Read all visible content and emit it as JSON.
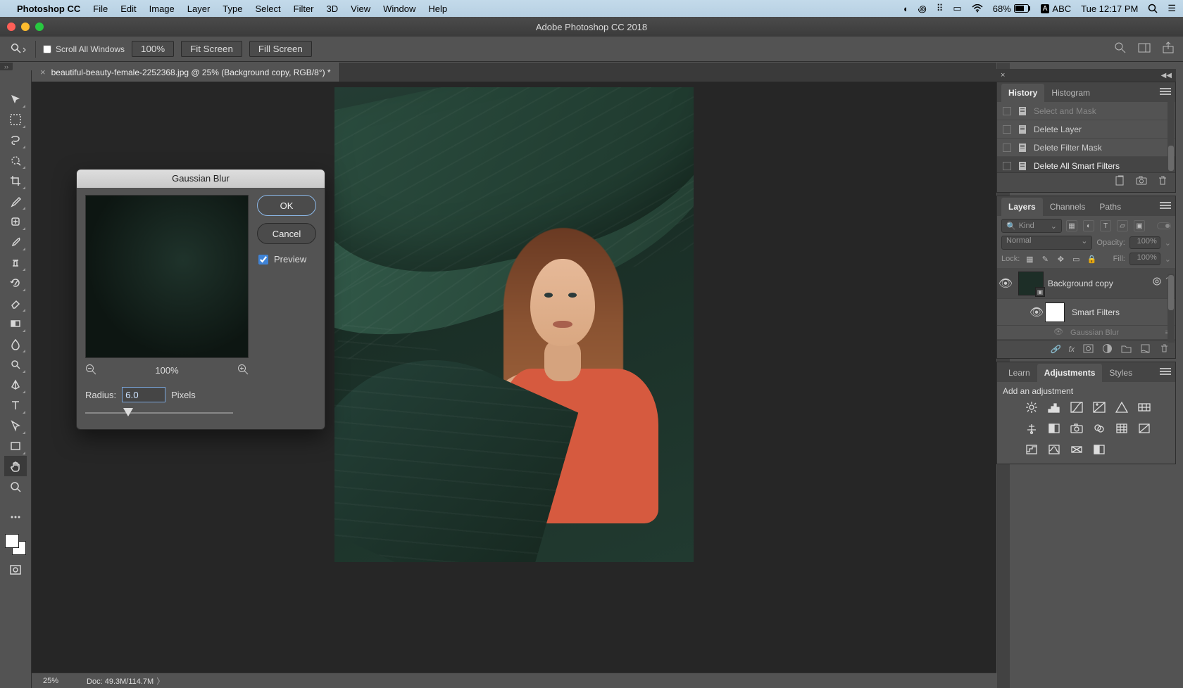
{
  "menubar": {
    "app": "Photoshop CC",
    "items": [
      "File",
      "Edit",
      "Image",
      "Layer",
      "Type",
      "Select",
      "Filter",
      "3D",
      "View",
      "Window",
      "Help"
    ],
    "battery": "68%",
    "input_badge": "A",
    "input_lang": "ABC",
    "clock": "Tue 12:17 PM"
  },
  "window": {
    "title": "Adobe Photoshop CC 2018"
  },
  "options_bar": {
    "scroll_all": "Scroll All Windows",
    "zoom": "100%",
    "fit": "Fit Screen",
    "fill": "Fill Screen"
  },
  "document_tab": {
    "close": "×",
    "label": "beautiful-beauty-female-2252368.jpg @ 25% (Background copy, RGB/8°) *"
  },
  "tools": [
    {
      "n": "move-tool"
    },
    {
      "n": "marquee-tool"
    },
    {
      "n": "lasso-tool"
    },
    {
      "n": "quick-select-tool"
    },
    {
      "n": "crop-tool"
    },
    {
      "n": "eyedropper-tool"
    },
    {
      "n": "healing-brush-tool"
    },
    {
      "n": "brush-tool"
    },
    {
      "n": "clone-stamp-tool"
    },
    {
      "n": "history-brush-tool"
    },
    {
      "n": "eraser-tool"
    },
    {
      "n": "gradient-tool"
    },
    {
      "n": "blur-tool"
    },
    {
      "n": "dodge-tool"
    },
    {
      "n": "pen-tool"
    },
    {
      "n": "type-tool"
    },
    {
      "n": "path-select-tool"
    },
    {
      "n": "rectangle-tool"
    },
    {
      "n": "hand-tool",
      "selected": true,
      "nofly": true
    },
    {
      "n": "zoom-tool",
      "nofly": true
    }
  ],
  "status": {
    "zoom": "25%",
    "doc": "Doc: 49.3M/114.7M"
  },
  "history_panel": {
    "tabs": [
      "History",
      "Histogram"
    ],
    "items": [
      {
        "label": "Select and Mask",
        "dim": true
      },
      {
        "label": "Delete Layer"
      },
      {
        "label": "Delete Filter Mask"
      },
      {
        "label": "Delete All Smart Filters",
        "selected": true
      }
    ]
  },
  "layers_panel": {
    "tabs": [
      "Layers",
      "Channels",
      "Paths"
    ],
    "kind_placeholder": "Kind",
    "blend_mode": "Normal",
    "opacity_label": "Opacity:",
    "opacity_value": "100%",
    "lock_label": "Lock:",
    "fill_label": "Fill:",
    "fill_value": "100%",
    "layer_name": "Background copy",
    "smart_filters_label": "Smart Filters",
    "hidden_effect": "Gaussian Blur"
  },
  "adjustments_panel": {
    "tabs": [
      "Learn",
      "Adjustments",
      "Styles"
    ],
    "hint": "Add an adjustment"
  },
  "gaussian_blur": {
    "title": "Gaussian Blur",
    "ok": "OK",
    "cancel": "Cancel",
    "preview": "Preview",
    "zoom": "100%",
    "radius_label": "Radius:",
    "radius_value": "6.0",
    "radius_unit": "Pixels"
  }
}
